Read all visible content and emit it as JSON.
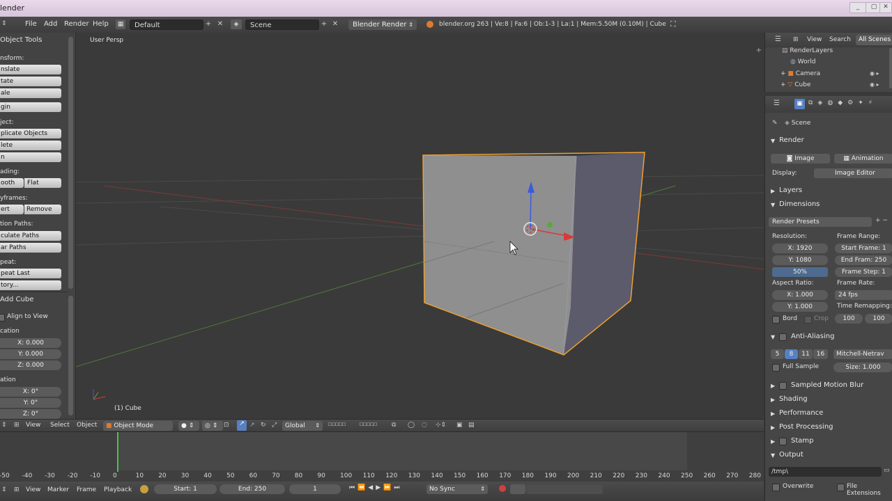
{
  "titlebar": {
    "title": "lender"
  },
  "infobar": {
    "menus": [
      "File",
      "Add",
      "Render",
      "Help"
    ],
    "screen_layout": "Default",
    "scene": "Scene",
    "engine": "Blender Render",
    "stats": "blender.org 263 | Ve:8 | Fa:6 | Ob:1-3 | La:1 | Mem:5.50M (0.10M) | Cube"
  },
  "toolshelf": {
    "title": "Object Tools",
    "transform_label": "nsform:",
    "transform_btns": [
      "nslate",
      "tate",
      "ale"
    ],
    "origin_btn": "gin",
    "object_label": "ject:",
    "object_btns": [
      "plicate Objects",
      "lete",
      "n"
    ],
    "shading_label": "ading:",
    "shading_btns": [
      "ooth",
      "Flat"
    ],
    "keyframes_label": "yframes:",
    "keyframes_btns": [
      "ert",
      "Remove"
    ],
    "motion_label": "tion Paths:",
    "motion_btns": [
      "culate Paths",
      "ar Paths"
    ],
    "repeat_label": "peat:",
    "repeat_btns": [
      "peat Last",
      "tory..."
    ],
    "add_cube": "Add Cube",
    "align_to_view": "Align to View",
    "location_label": "cation",
    "location": [
      "X: 0.000",
      "Y: 0.000",
      "Z: 0.000"
    ],
    "rotation_label": "ation",
    "rotation": [
      "X: 0°",
      "Y: 0°",
      "Z: 0°"
    ]
  },
  "viewport": {
    "persp_label": "User Persp",
    "object_label": "(1) Cube"
  },
  "vp_header": {
    "menus": [
      "View",
      "Select",
      "Object"
    ],
    "mode": "Object Mode",
    "orientation": "Global"
  },
  "timeline": {
    "ruler": [
      "-50",
      "-40",
      "-30",
      "-20",
      "-10",
      "0",
      "10",
      "20",
      "30",
      "40",
      "50",
      "60",
      "70",
      "80",
      "90",
      "100",
      "110",
      "120",
      "130",
      "140",
      "150",
      "160",
      "170",
      "180",
      "190",
      "200",
      "210",
      "220",
      "230",
      "240",
      "250",
      "260",
      "270",
      "280"
    ],
    "menus": [
      "View",
      "Marker",
      "Frame",
      "Playback"
    ],
    "start": "Start: 1",
    "end": "End: 250",
    "current": "1",
    "sync": "No Sync"
  },
  "outliner": {
    "menus": [
      "View",
      "Search"
    ],
    "filter": "All Scenes",
    "items": [
      "RenderLayers",
      "World",
      "Camera",
      "Cube"
    ]
  },
  "properties": {
    "scene": "Scene",
    "render_panel": "Render",
    "image_btn": "Image",
    "animation_btn": "Animation",
    "display_label": "Display:",
    "display_value": "Image Editor",
    "layers": "Layers",
    "dimensions": "Dimensions",
    "render_presets": "Render Presets",
    "resolution_label": "Resolution:",
    "res_x": "X: 1920",
    "res_y": "Y: 1080",
    "res_pct": "50%",
    "frame_range_label": "Frame Range:",
    "start_frame": "Start Frame: 1",
    "end_frame": "End Fram: 250",
    "frame_step": "Frame Step: 1",
    "aspect_label": "Aspect Ratio:",
    "aspect_x": "X: 1.000",
    "aspect_y": "Y: 1.000",
    "frame_rate_label": "Frame Rate:",
    "frame_rate": "24 fps",
    "time_remap_label": "Time Remapping:",
    "remap_old": "100",
    "remap_new": "100",
    "bord": "Bord",
    "crop": "Crop",
    "anti_aliasing": "Anti-Aliasing",
    "aa_samples": [
      "5",
      "8",
      "11",
      "16"
    ],
    "filter": "Mitchell-Netrav",
    "full_sample": "Full Sample",
    "size": "Size: 1.000",
    "sampled_motion_blur": "Sampled Motion Blur",
    "shading": "Shading",
    "performance": "Performance",
    "post_processing": "Post Processing",
    "stamp": "Stamp",
    "output": "Output",
    "output_path": "/tmp\\",
    "overwrite": "Overwrite",
    "file_extensions": "File Extensions"
  },
  "colors": {
    "selection_outline": "#f0a030",
    "x_axis": "#d83a3a",
    "y_axis": "#5aa83a",
    "z_axis": "#3a5ae0",
    "active_sample": "#5680c2"
  }
}
